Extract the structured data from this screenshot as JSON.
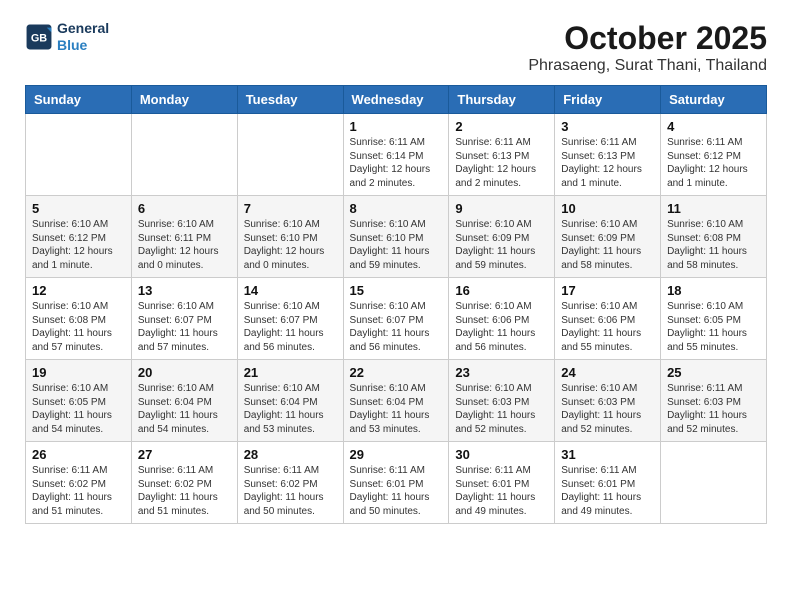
{
  "logo": {
    "line1": "General",
    "line2": "Blue"
  },
  "title": "October 2025",
  "subtitle": "Phrasaeng, Surat Thani, Thailand",
  "weekdays": [
    "Sunday",
    "Monday",
    "Tuesday",
    "Wednesday",
    "Thursday",
    "Friday",
    "Saturday"
  ],
  "weeks": [
    [
      {
        "day": "",
        "info": ""
      },
      {
        "day": "",
        "info": ""
      },
      {
        "day": "",
        "info": ""
      },
      {
        "day": "1",
        "info": "Sunrise: 6:11 AM\nSunset: 6:14 PM\nDaylight: 12 hours and 2 minutes."
      },
      {
        "day": "2",
        "info": "Sunrise: 6:11 AM\nSunset: 6:13 PM\nDaylight: 12 hours and 2 minutes."
      },
      {
        "day": "3",
        "info": "Sunrise: 6:11 AM\nSunset: 6:13 PM\nDaylight: 12 hours and 1 minute."
      },
      {
        "day": "4",
        "info": "Sunrise: 6:11 AM\nSunset: 6:12 PM\nDaylight: 12 hours and 1 minute."
      }
    ],
    [
      {
        "day": "5",
        "info": "Sunrise: 6:10 AM\nSunset: 6:12 PM\nDaylight: 12 hours and 1 minute."
      },
      {
        "day": "6",
        "info": "Sunrise: 6:10 AM\nSunset: 6:11 PM\nDaylight: 12 hours and 0 minutes."
      },
      {
        "day": "7",
        "info": "Sunrise: 6:10 AM\nSunset: 6:10 PM\nDaylight: 12 hours and 0 minutes."
      },
      {
        "day": "8",
        "info": "Sunrise: 6:10 AM\nSunset: 6:10 PM\nDaylight: 11 hours and 59 minutes."
      },
      {
        "day": "9",
        "info": "Sunrise: 6:10 AM\nSunset: 6:09 PM\nDaylight: 11 hours and 59 minutes."
      },
      {
        "day": "10",
        "info": "Sunrise: 6:10 AM\nSunset: 6:09 PM\nDaylight: 11 hours and 58 minutes."
      },
      {
        "day": "11",
        "info": "Sunrise: 6:10 AM\nSunset: 6:08 PM\nDaylight: 11 hours and 58 minutes."
      }
    ],
    [
      {
        "day": "12",
        "info": "Sunrise: 6:10 AM\nSunset: 6:08 PM\nDaylight: 11 hours and 57 minutes."
      },
      {
        "day": "13",
        "info": "Sunrise: 6:10 AM\nSunset: 6:07 PM\nDaylight: 11 hours and 57 minutes."
      },
      {
        "day": "14",
        "info": "Sunrise: 6:10 AM\nSunset: 6:07 PM\nDaylight: 11 hours and 56 minutes."
      },
      {
        "day": "15",
        "info": "Sunrise: 6:10 AM\nSunset: 6:07 PM\nDaylight: 11 hours and 56 minutes."
      },
      {
        "day": "16",
        "info": "Sunrise: 6:10 AM\nSunset: 6:06 PM\nDaylight: 11 hours and 56 minutes."
      },
      {
        "day": "17",
        "info": "Sunrise: 6:10 AM\nSunset: 6:06 PM\nDaylight: 11 hours and 55 minutes."
      },
      {
        "day": "18",
        "info": "Sunrise: 6:10 AM\nSunset: 6:05 PM\nDaylight: 11 hours and 55 minutes."
      }
    ],
    [
      {
        "day": "19",
        "info": "Sunrise: 6:10 AM\nSunset: 6:05 PM\nDaylight: 11 hours and 54 minutes."
      },
      {
        "day": "20",
        "info": "Sunrise: 6:10 AM\nSunset: 6:04 PM\nDaylight: 11 hours and 54 minutes."
      },
      {
        "day": "21",
        "info": "Sunrise: 6:10 AM\nSunset: 6:04 PM\nDaylight: 11 hours and 53 minutes."
      },
      {
        "day": "22",
        "info": "Sunrise: 6:10 AM\nSunset: 6:04 PM\nDaylight: 11 hours and 53 minutes."
      },
      {
        "day": "23",
        "info": "Sunrise: 6:10 AM\nSunset: 6:03 PM\nDaylight: 11 hours and 52 minutes."
      },
      {
        "day": "24",
        "info": "Sunrise: 6:10 AM\nSunset: 6:03 PM\nDaylight: 11 hours and 52 minutes."
      },
      {
        "day": "25",
        "info": "Sunrise: 6:11 AM\nSunset: 6:03 PM\nDaylight: 11 hours and 52 minutes."
      }
    ],
    [
      {
        "day": "26",
        "info": "Sunrise: 6:11 AM\nSunset: 6:02 PM\nDaylight: 11 hours and 51 minutes."
      },
      {
        "day": "27",
        "info": "Sunrise: 6:11 AM\nSunset: 6:02 PM\nDaylight: 11 hours and 51 minutes."
      },
      {
        "day": "28",
        "info": "Sunrise: 6:11 AM\nSunset: 6:02 PM\nDaylight: 11 hours and 50 minutes."
      },
      {
        "day": "29",
        "info": "Sunrise: 6:11 AM\nSunset: 6:01 PM\nDaylight: 11 hours and 50 minutes."
      },
      {
        "day": "30",
        "info": "Sunrise: 6:11 AM\nSunset: 6:01 PM\nDaylight: 11 hours and 49 minutes."
      },
      {
        "day": "31",
        "info": "Sunrise: 6:11 AM\nSunset: 6:01 PM\nDaylight: 11 hours and 49 minutes."
      },
      {
        "day": "",
        "info": ""
      }
    ]
  ]
}
